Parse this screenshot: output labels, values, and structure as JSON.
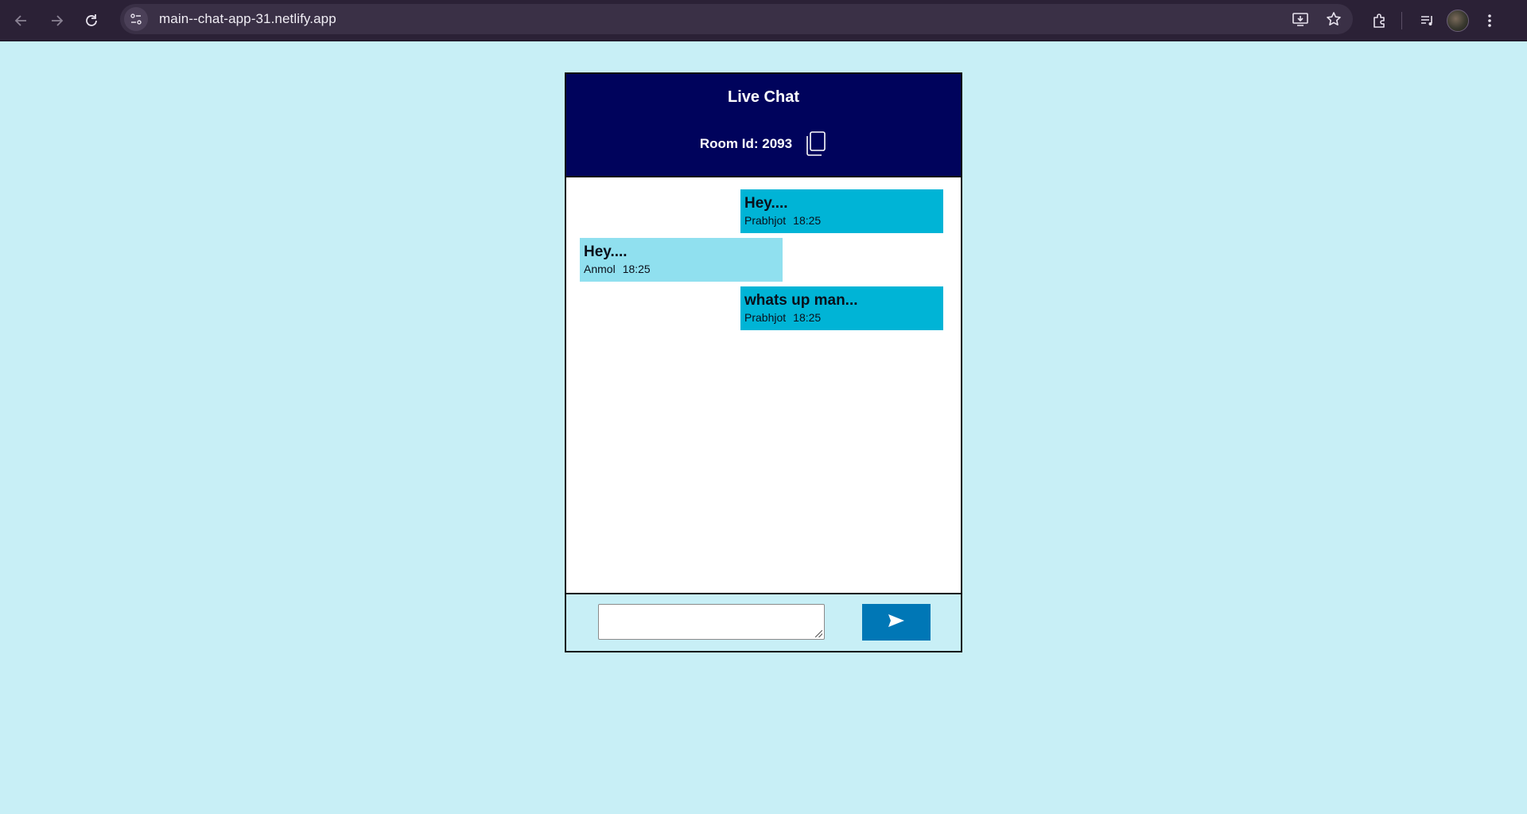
{
  "browser": {
    "url": "main--chat-app-31.netlify.app",
    "icons": [
      "back-arrow-icon",
      "forward-arrow-icon",
      "reload-icon",
      "site-info-icon",
      "install-app-icon",
      "bookmark-star-icon",
      "extensions-icon",
      "media-controls-icon",
      "profile-avatar",
      "kebab-menu-icon"
    ]
  },
  "chat": {
    "title": "Live Chat",
    "room_label": "Room Id: 2093",
    "copy_icon": "copy-icon",
    "messages": [
      {
        "text": "Hey....",
        "author": "Prabhjot",
        "time": "18:25",
        "direction": "sent"
      },
      {
        "text": "Hey....",
        "author": "Anmol",
        "time": "18:25",
        "direction": "received"
      },
      {
        "text": "whats up man...",
        "author": "Prabhjot",
        "time": "18:25",
        "direction": "sent"
      }
    ],
    "input": {
      "value": "",
      "placeholder": ""
    },
    "send_icon": "send-icon"
  },
  "colors": {
    "page_background": "#c8eff6",
    "header_background": "#00035c",
    "sent_bubble": "#00b4d6",
    "received_bubble": "#90e0ef",
    "send_button": "#0077b6"
  }
}
